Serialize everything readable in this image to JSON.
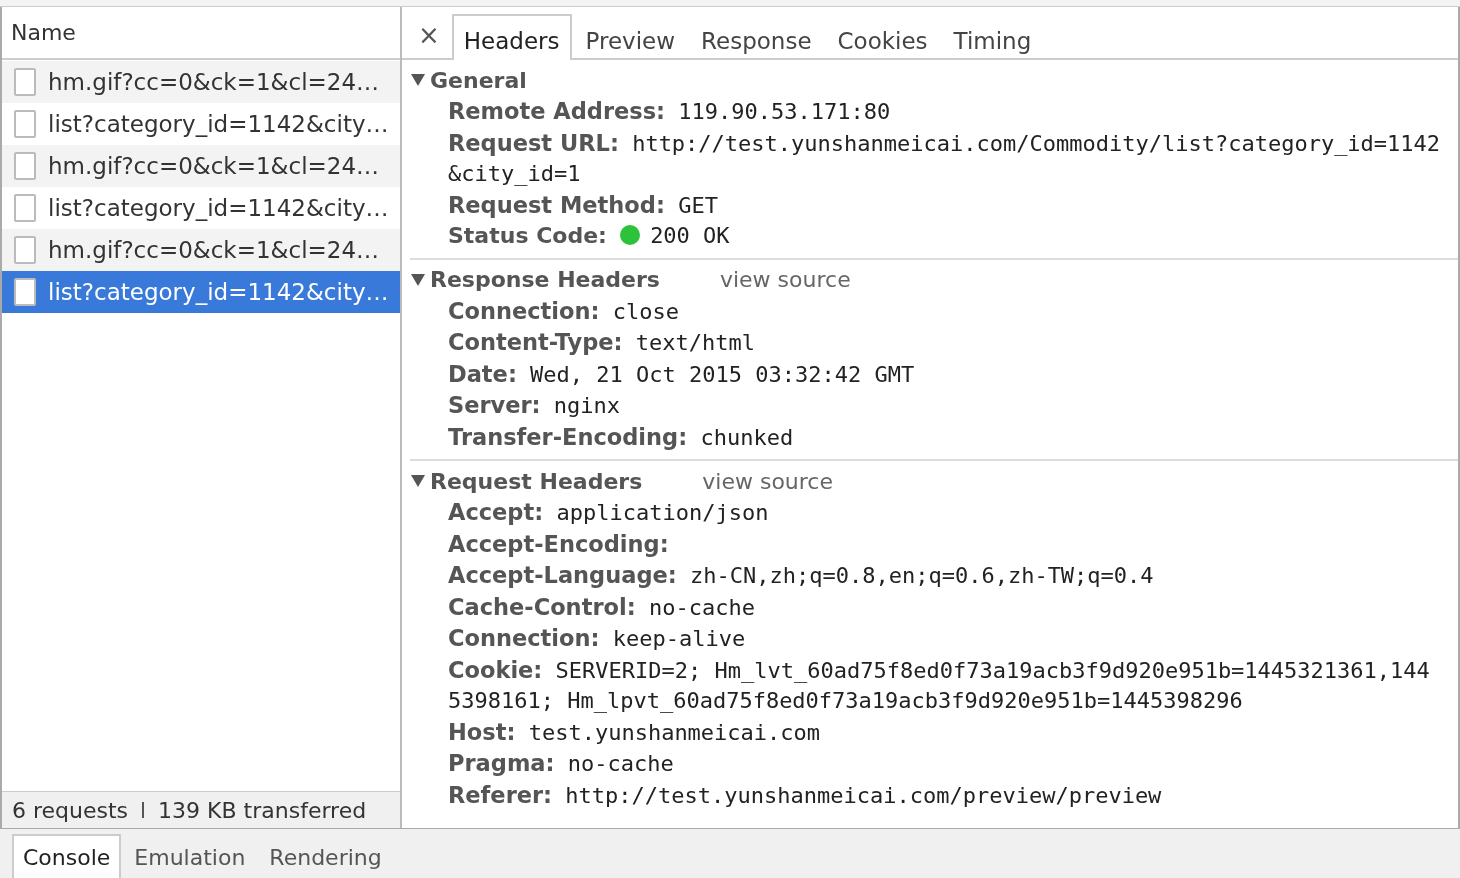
{
  "requests_panel": {
    "column_header": "Name",
    "rows": [
      {
        "name": "hm.gif?cc=0&ck=1&cl=24…",
        "selected": false
      },
      {
        "name": "list?category_id=1142&city…",
        "selected": false
      },
      {
        "name": "hm.gif?cc=0&ck=1&cl=24…",
        "selected": false
      },
      {
        "name": "list?category_id=1142&city…",
        "selected": false
      },
      {
        "name": "hm.gif?cc=0&ck=1&cl=24…",
        "selected": false
      },
      {
        "name": "list?category_id=1142&city…",
        "selected": true
      }
    ],
    "summary": [
      "6 requests",
      "139 KB transferred"
    ]
  },
  "details": {
    "close": "×",
    "tabs": [
      {
        "label": "Headers",
        "selected": true
      },
      {
        "label": "Preview",
        "selected": false
      },
      {
        "label": "Response",
        "selected": false
      },
      {
        "label": "Cookies",
        "selected": false
      },
      {
        "label": "Timing",
        "selected": false
      }
    ],
    "sections": [
      {
        "title": "General",
        "expanded": true,
        "fields": [
          {
            "name": "Remote Address:",
            "value": "119.90.53.171:80"
          },
          {
            "name": "Request URL:",
            "value": "http://test.yunshanmeicai.com/Commodity/list?category_id=1142&city_id=1"
          },
          {
            "name": "Request Method:",
            "value": "GET"
          },
          {
            "name": "Status Code:",
            "value": "200 OK",
            "color": "#2cc23a"
          }
        ]
      },
      {
        "title": "Response Headers",
        "link": "view source",
        "expanded": true,
        "fields": [
          {
            "name": "Connection:",
            "value": "close"
          },
          {
            "name": "Content-Type:",
            "value": "text/html"
          },
          {
            "name": "Date:",
            "value": "Wed, 21 Oct 2015 03:32:42 GMT"
          },
          {
            "name": "Server:",
            "value": "nginx"
          },
          {
            "name": "Transfer-Encoding:",
            "value": "chunked"
          }
        ]
      },
      {
        "title": "Request Headers",
        "link": "view source",
        "expanded": true,
        "fields": [
          {
            "name": "Accept:",
            "value": "application/json"
          },
          {
            "name": "Accept-Encoding:"
          },
          {
            "name": "Accept-Language:",
            "value": "zh-CN,zh;q=0.8,en;q=0.6,zh-TW;q=0.4"
          },
          {
            "name": "Cache-Control:",
            "value": "no-cache"
          },
          {
            "name": "Connection:",
            "value": "keep-alive"
          },
          {
            "name": "Cookie:",
            "value": "SERVERID=2; Hm_lvt_60ad75f8ed0f73a19acb3f9d920e951b=1445321361,1445398161; Hm_lpvt_60ad75f8ed0f73a19acb3f9d920e951b=1445398296"
          },
          {
            "name": "Host:",
            "value": "test.yunshanmeicai.com"
          },
          {
            "name": "Pragma:",
            "value": "no-cache"
          },
          {
            "name": "Referer:",
            "value": "http://test.yunshanmeicai.com/preview/preview"
          }
        ]
      }
    ]
  },
  "drawer_tabs": [
    {
      "label": "Console",
      "selected": true
    },
    {
      "label": "Emulation",
      "selected": false
    },
    {
      "label": "Rendering",
      "selected": false
    }
  ]
}
